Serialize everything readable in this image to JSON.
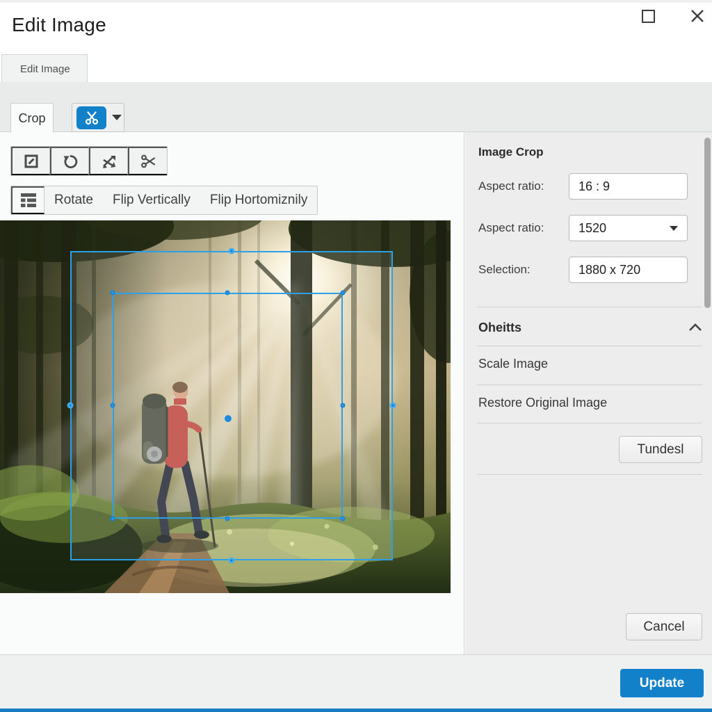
{
  "window": {
    "title": "Edit Image",
    "controls": {
      "maximize_icon": "maximize-icon",
      "close_icon": "close-icon"
    }
  },
  "tab_bar": {
    "active_tab": "Edit Image"
  },
  "toolbar": {
    "crop_tab_label": "Crop",
    "split_button_icon": "scissors-icon",
    "icon_buttons": [
      "edit-crop-icon",
      "rotate-icon",
      "swap-arrows-icon",
      "scissors-icon"
    ]
  },
  "transform_row": {
    "layout_icon": "layout-list-icon",
    "buttons": [
      "Rotate",
      "Flip Vertically",
      "Flip Hortomiznily"
    ]
  },
  "crop_panel": {
    "heading": "Image Crop",
    "aspect_ratio_label": "Aspect ratio:",
    "aspect_ratio_value": "16 : 9",
    "aspect_ratio2_label": "Aspect ratio:",
    "aspect_ratio2_value": "1520",
    "selection_label": "Selection:",
    "selection_value": "1880 x 720"
  },
  "options_section": {
    "title": "Oheitts",
    "collapse_icon": "chevron-up-icon",
    "items": [
      "Scale Image",
      "Restore Original Image"
    ],
    "action_button": "Tundesl"
  },
  "actions": {
    "cancel": "Cancel",
    "update": "Update"
  },
  "image": {
    "description": "Hiker with backpack and trekking pole on a forest trail with sun rays through trees"
  },
  "colors": {
    "accent_blue": "#1381ca",
    "crop_overlay_blue": "#2aa1e8",
    "footer_bar_blue": "#1a7dc2"
  }
}
